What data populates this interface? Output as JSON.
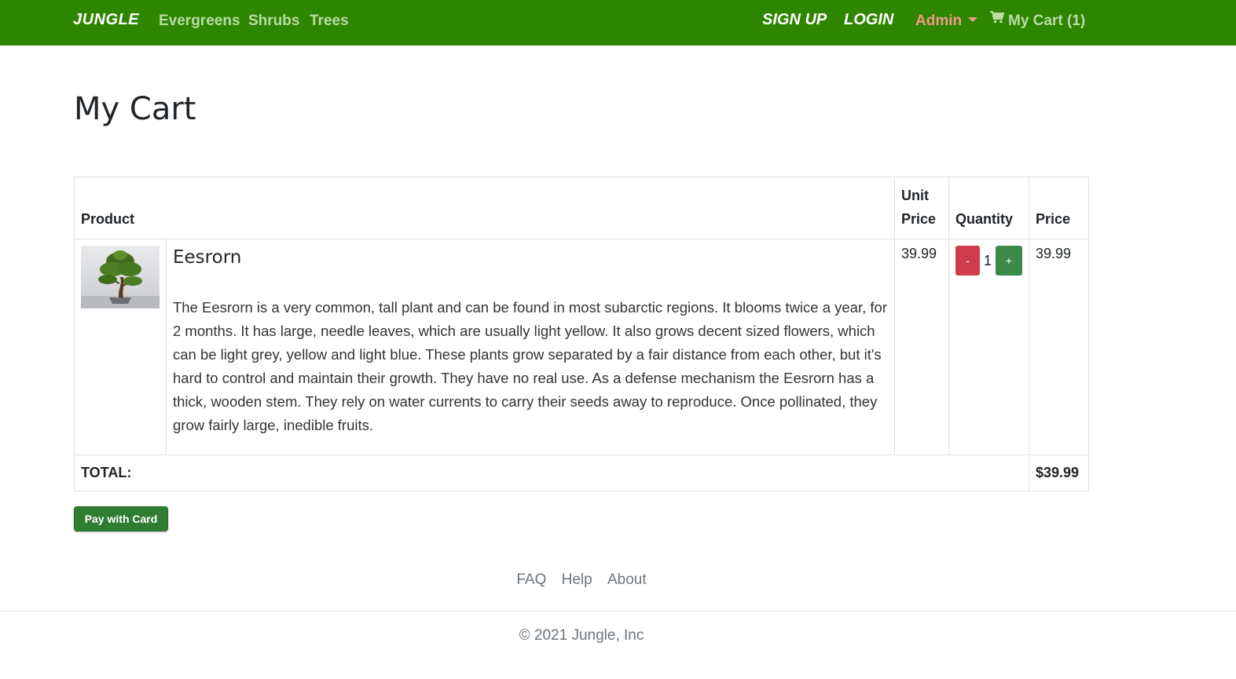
{
  "nav": {
    "brand": "JUNGLE",
    "links": [
      "Evergreens",
      "Shrubs",
      "Trees"
    ],
    "signup": "SIGN UP",
    "login": "LOGIN",
    "admin": "Admin",
    "cart": "My Cart (1)"
  },
  "page": {
    "title": "My Cart"
  },
  "table": {
    "headers": {
      "product": "Product",
      "unit_price": "Unit Price",
      "quantity": "Quantity",
      "price": "Price"
    },
    "rows": [
      {
        "name": "Eesrorn",
        "description": "The Eesrorn is a very common, tall plant and can be found in most subarctic regions. It blooms twice a year, for 2 months. It has large, needle leaves, which are usually light yellow. It also grows decent sized flowers, which can be light grey, yellow and light blue. These plants grow separated by a fair distance from each other, but it's hard to control and maintain their growth. They have no real use. As a defense mechanism the Eesrorn has a thick, wooden stem. They rely on water currents to carry their seeds away to reproduce. Once pollinated, they grow fairly large, inedible fruits.",
        "unit_price": "39.99",
        "decrement": "-",
        "quantity": "1",
        "increment": "+",
        "price": "39.99"
      }
    ],
    "total_label": "TOTAL:",
    "total_value": "$39.99"
  },
  "actions": {
    "pay": "Pay with Card"
  },
  "footer": {
    "links": [
      "FAQ",
      "Help",
      "About"
    ],
    "copyright": "© 2021 Jungle, Inc"
  },
  "colors": {
    "navbar": "#2e8500",
    "admin": "#f09a8a",
    "minus": "#cf3d4c",
    "plus": "#3b8a48",
    "pay": "#2f7d32"
  }
}
